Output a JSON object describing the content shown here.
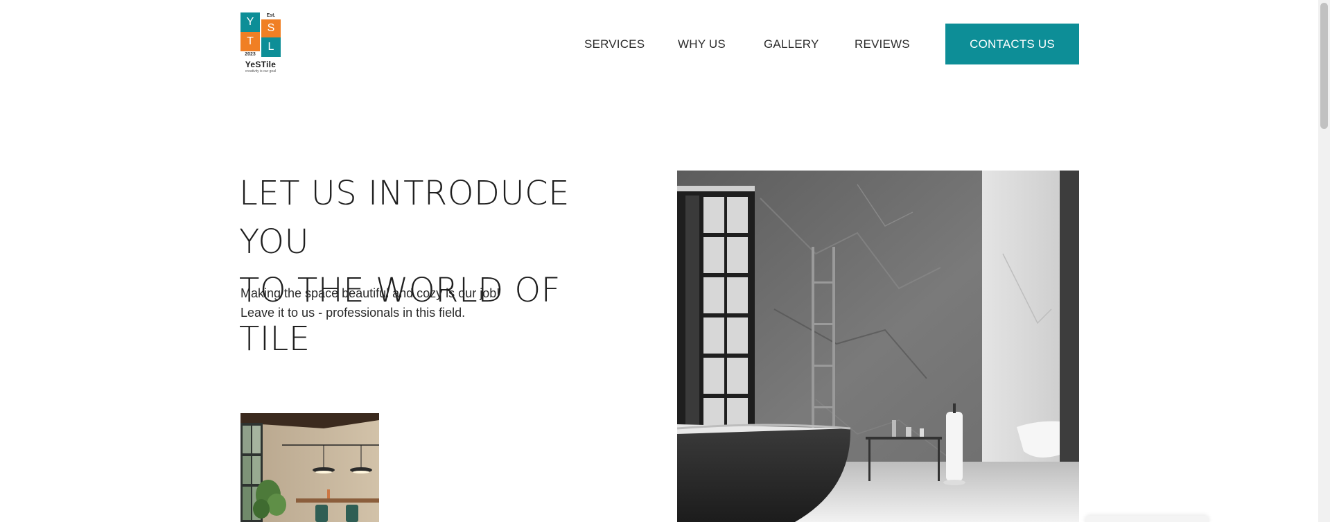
{
  "logo": {
    "letters": [
      "Y",
      "S",
      "T",
      "L"
    ],
    "est": "Est.",
    "year": "2023",
    "name": "YeSTile",
    "tagline": "creativity is our goal",
    "colors": {
      "teal": "#0d8e97",
      "orange": "#f07f24"
    }
  },
  "nav": {
    "items": [
      {
        "label": "SERVICES"
      },
      {
        "label": "WHY US"
      },
      {
        "label": "GALLERY"
      },
      {
        "label": "REVIEWS"
      }
    ],
    "cta_label": "CONTACTS US"
  },
  "hero": {
    "title_line1": "LET US INTRODUCE YOU",
    "title_line2": "TO THE WORLD OF TILE",
    "sub_line1": "Making the space beautiful and cozy is our job!",
    "sub_line2": "Leave it to us - professionals in this field."
  },
  "images": {
    "thumbnail": "interior-dining-photo",
    "main": "marble-bathroom-photo"
  },
  "colors": {
    "accent": "#0d8e97",
    "text": "#222222"
  }
}
